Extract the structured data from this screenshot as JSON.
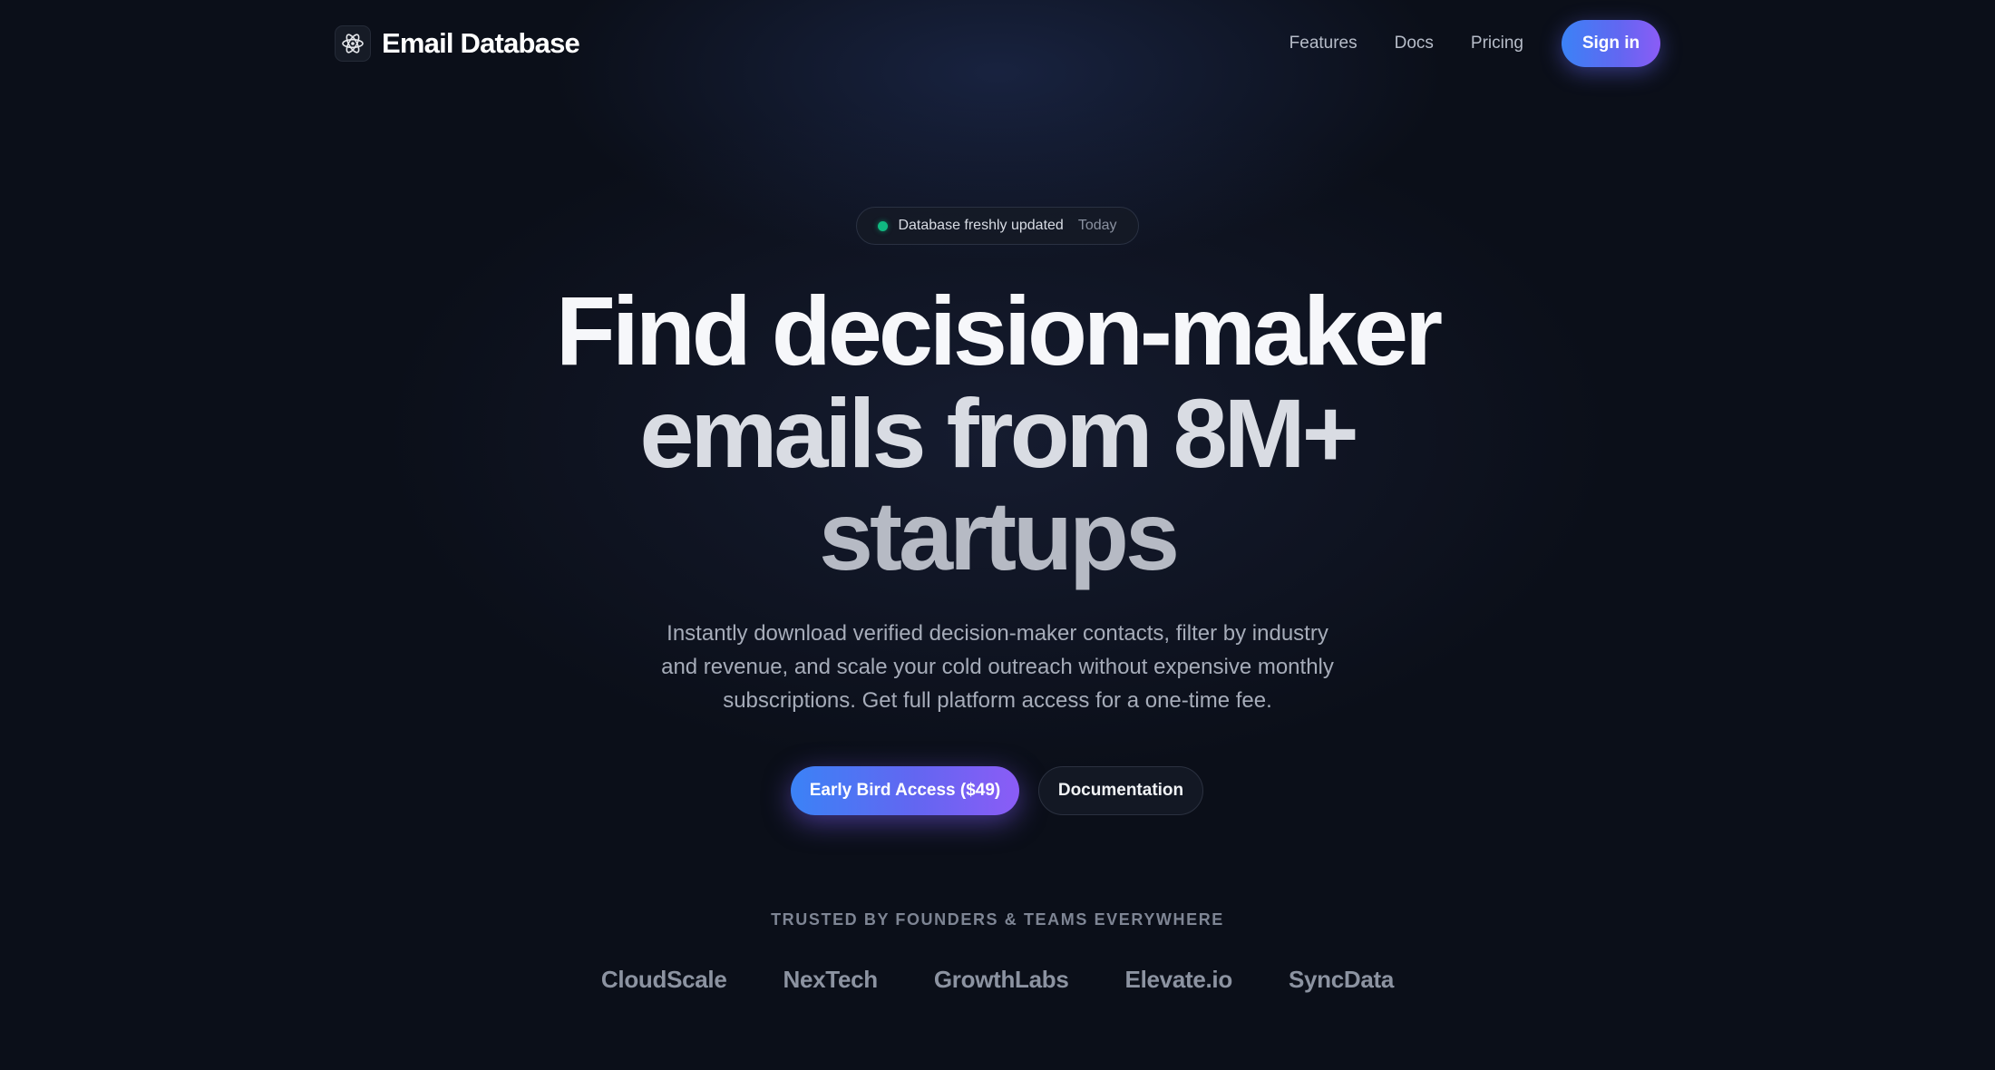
{
  "nav": {
    "brand_name": "Email Database",
    "logo_icon": "atom-icon",
    "links": [
      {
        "label": "Features"
      },
      {
        "label": "Docs"
      },
      {
        "label": "Pricing"
      }
    ],
    "signin_label": "Sign in"
  },
  "hero": {
    "badge": {
      "status_color": "#10b981",
      "text": "Database freshly updated",
      "time": "Today"
    },
    "headline_lines": [
      "Find decision-maker",
      "emails from 8M+",
      "startups"
    ],
    "subtitle_lines": [
      "Instantly download verified decision-maker contacts, filter by industry",
      "and revenue, and scale your cold outreach without expensive monthly",
      "subscriptions. Get full platform access for a one-time fee."
    ],
    "primary_cta": "Early Bird Access ($49)",
    "secondary_cta": "Documentation"
  },
  "trusted": {
    "title": "TRUSTED BY FOUNDERS & TEAMS EVERYWHERE",
    "logos": [
      "CloudScale",
      "NexTech",
      "GrowthLabs",
      "Elevate.io",
      "SyncData"
    ]
  },
  "colors": {
    "background": "#0b0f19",
    "accent_start": "#3b82f6",
    "accent_end": "#8b5cf6"
  }
}
